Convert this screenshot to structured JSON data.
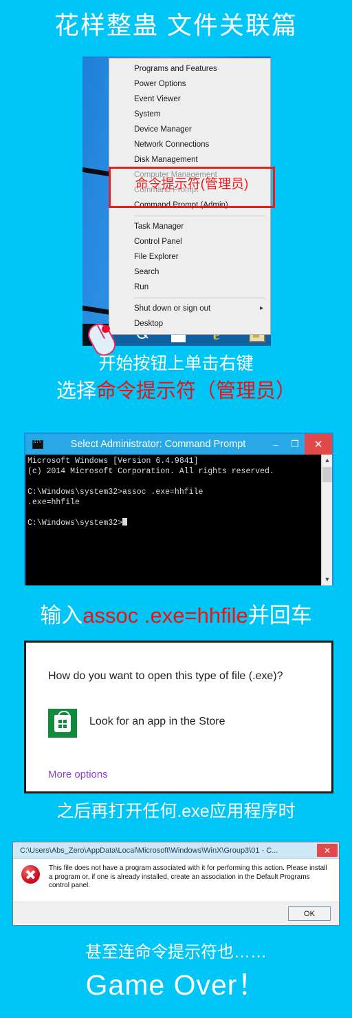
{
  "headline": "花样整蛊 文件关联篇",
  "colors": {
    "background": "#00c6f7",
    "caption_white": "#ffffff",
    "caption_red": "#ee1111",
    "highlight_red": "#ee1c1c",
    "store_green": "#128a3c",
    "link_purple": "#8c3fd6"
  },
  "winx_menu": {
    "items": [
      {
        "label": "Programs and Features",
        "dim": false,
        "submenu": false
      },
      {
        "label": "Power Options",
        "dim": false,
        "submenu": false
      },
      {
        "label": "Event Viewer",
        "dim": false,
        "submenu": false
      },
      {
        "label": "System",
        "dim": false,
        "submenu": false
      },
      {
        "label": "Device Manager",
        "dim": false,
        "submenu": false
      },
      {
        "label": "Network Connections",
        "dim": false,
        "submenu": false
      },
      {
        "label": "Disk Management",
        "dim": false,
        "submenu": false
      },
      {
        "label": "Computer Management",
        "dim": true,
        "submenu": false
      },
      {
        "label": "Command Prompt",
        "dim": true,
        "submenu": false
      },
      {
        "label": "Command Prompt (Admin)",
        "dim": false,
        "submenu": false
      },
      {
        "label": "Task Manager",
        "dim": false,
        "submenu": false
      },
      {
        "label": "Control Panel",
        "dim": false,
        "submenu": false
      },
      {
        "label": "File Explorer",
        "dim": false,
        "submenu": false
      },
      {
        "label": "Search",
        "dim": false,
        "submenu": false
      },
      {
        "label": "Run",
        "dim": false,
        "submenu": false
      },
      {
        "label": "Shut down or sign out",
        "dim": false,
        "submenu": true
      },
      {
        "label": "Desktop",
        "dim": false,
        "submenu": false
      }
    ],
    "highlight_label": "命令提示符(管理员)"
  },
  "taskbar": {
    "icons": [
      "search-icon",
      "window-icon",
      "internet-explorer-icon",
      "folder-icon"
    ],
    "ie_glyph": "e"
  },
  "caption1": "开始按钮上单击右键",
  "caption2": {
    "prefix": "选择",
    "emphasis": "命令提示符（管理员）"
  },
  "command_prompt": {
    "title": "Select Administrator: Command Prompt",
    "minimize_label": "–",
    "maximize_label": "❐",
    "close_label": "✕",
    "scroll_up_label": "▲",
    "scroll_down_label": "▼",
    "lines": [
      "Microsoft Windows [Version 6.4.9841]",
      "(c) 2014 Microsoft Corporation. All rights reserved.",
      "",
      "C:\\Windows\\system32>assoc .exe=hhfile",
      ".exe=hhfile",
      "",
      "C:\\Windows\\system32>"
    ]
  },
  "caption3": {
    "prefix": "输入",
    "emphasis": "assoc .exe=hhfile",
    "suffix": "并回车"
  },
  "open_with_dialog": {
    "question": "How do you want to open this type of file (.exe)?",
    "store_option": "Look for an app in the Store",
    "more_options": "More options"
  },
  "caption4": "之后再打开任何.exe应用程序时",
  "error_dialog": {
    "title": "C:\\Users\\Abs_Zero\\AppData\\Local\\Microsoft\\Windows\\WinX\\Group3\\01 - C...",
    "close_label": "✕",
    "message": "This file does not have a program associated with it for performing this action. Please install a program or, if one is already installed, create an association in the Default Programs control panel.",
    "ok_label": "OK"
  },
  "caption5": "甚至连命令提示符也……",
  "caption6": "Game Over！"
}
